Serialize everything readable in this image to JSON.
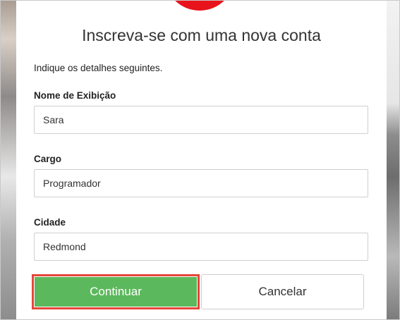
{
  "form": {
    "title": "Inscreva-se com uma nova conta",
    "instructions": "Indique os detalhes seguintes.",
    "fields": [
      {
        "label": "Nome de Exibição",
        "value": "Sara"
      },
      {
        "label": "Cargo",
        "value": "Programador"
      },
      {
        "label": "Cidade",
        "value": "Redmond"
      }
    ],
    "buttons": {
      "continue_label": "Continuar",
      "cancel_label": "Cancelar"
    }
  },
  "colors": {
    "primary_button": "#5cb85c",
    "highlight_border": "#e8453c",
    "logo": "#e8141b"
  }
}
